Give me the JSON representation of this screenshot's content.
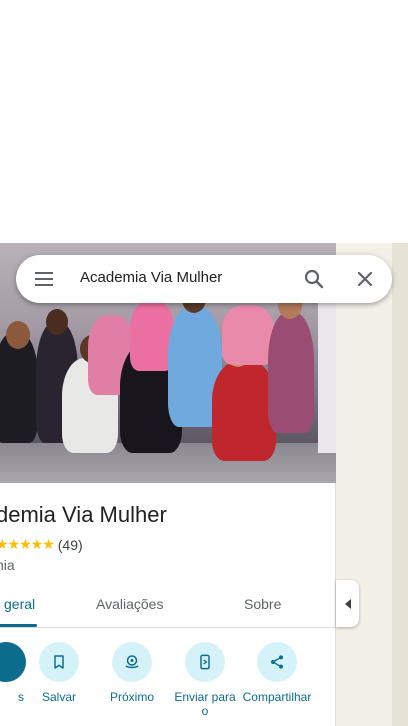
{
  "search": {
    "query": "Academia Via Mulher"
  },
  "place": {
    "name": "Academia Via Mulher",
    "name_visible": "demia Via Mulher",
    "stars": "★★★★★",
    "rating_count": "(49)",
    "category_visible": "nia"
  },
  "tabs": [
    {
      "label": "geral",
      "active": true
    },
    {
      "label": "Avaliações",
      "active": false
    },
    {
      "label": "Sobre",
      "active": false
    }
  ],
  "actions": [
    {
      "label": "s",
      "icon": "directions-icon"
    },
    {
      "label": "Salvar",
      "icon": "bookmark-icon"
    },
    {
      "label": "Próximo",
      "icon": "nearby-icon"
    },
    {
      "label": "Enviar para o",
      "icon": "send-to-phone-icon"
    },
    {
      "label": "Compartilhar",
      "icon": "share-icon"
    }
  ],
  "colors": {
    "accent": "#0b6c8c",
    "action_bg": "#d6f2f9",
    "star": "#fbbc04"
  }
}
